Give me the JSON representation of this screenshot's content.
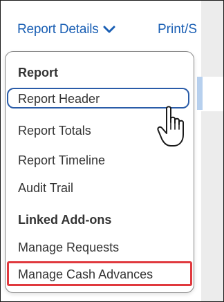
{
  "toolbar": {
    "report_details_label": "Report Details",
    "print_label": "Print/S"
  },
  "dropdown": {
    "report_section": {
      "header": "Report",
      "items": [
        {
          "label": "Report Header"
        },
        {
          "label": "Report Totals"
        },
        {
          "label": "Report Timeline"
        },
        {
          "label": "Audit Trail"
        }
      ]
    },
    "addons_section": {
      "header": "Linked Add-ons",
      "items": [
        {
          "label": "Manage Requests"
        },
        {
          "label": "Manage Cash Advances"
        }
      ]
    }
  },
  "colors": {
    "link_blue": "#1a5fb4",
    "focus_border": "#2a5ca8",
    "highlight_red": "#e0393e",
    "menu_text": "#333333"
  },
  "icons": {
    "dropdown_chevron": "chevron-down-icon",
    "pointer": "hand-pointer-icon"
  }
}
